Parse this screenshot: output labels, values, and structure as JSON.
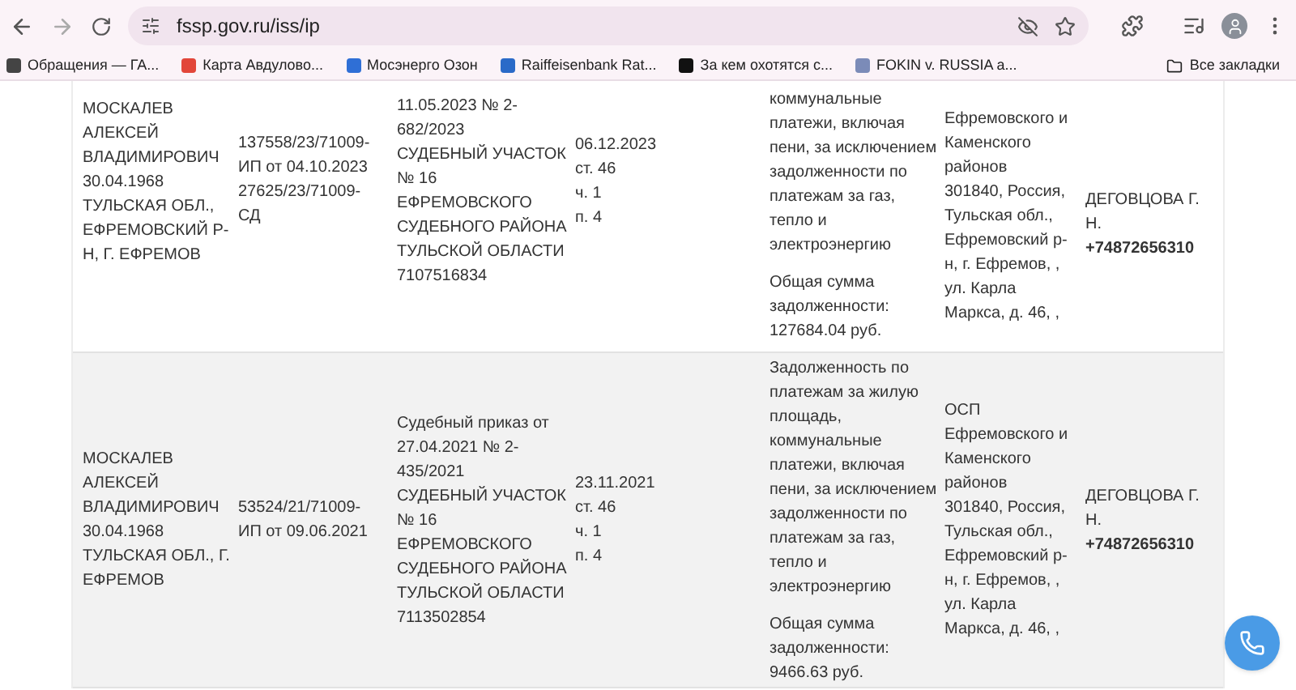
{
  "browser": {
    "url": "fssp.gov.ru/iss/ip",
    "all_bookmarks": "Все закладки",
    "bookmarks": [
      {
        "label": "Обращения — ГА...",
        "color": "#444444"
      },
      {
        "label": "Карта Авдулово...",
        "color": "#e2463a"
      },
      {
        "label": "Мосэнерго Озон",
        "color": "#2f6fd6"
      },
      {
        "label": "Raiffeisenbank Rat...",
        "color": "#2a6ac8"
      },
      {
        "label": "За кем охотятся с...",
        "color": "#111111"
      },
      {
        "label": "FOKIN v. RUSSIA a...",
        "color": "#7b8bb8"
      }
    ]
  },
  "rows": [
    {
      "hovered": false,
      "debtor": [
        "МОСКАЛЕВ",
        "АЛЕКСЕЙ",
        "ВЛАДИМИРОВИЧ",
        "30.04.1968",
        "ТУЛЬСКАЯ ОБЛ.,",
        "ЕФРЕМОВСКИЙ Р-",
        "Н, Г. ЕФРЕМОВ"
      ],
      "proceeding": [
        "137558/23/71009-",
        "ИП от 04.10.2023",
        "27625/23/71009-",
        "СД"
      ],
      "document": [
        "11.05.2023 № 2-",
        "682/2023",
        "СУДЕБНЫЙ УЧАСТОК",
        "№ 16",
        "ЕФРЕМОВСКОГО",
        "СУДЕБНОГО РАЙОНА",
        "ТУЛЬСКОЙ ОБЛАСТИ",
        "7107516834"
      ],
      "ended": [
        "06.12.2023",
        "ст. 46",
        "ч. 1",
        "п. 4"
      ],
      "subject": [
        "коммунальные",
        "платежи, включая",
        "пени, за исключением",
        "задолженности по",
        "платежам за газ,",
        "тепло и",
        "электроэнергию"
      ],
      "total": [
        "Общая сумма",
        "задолженности:",
        "127684.04 руб."
      ],
      "department": [
        "Ефремовского и",
        "Каменского",
        "районов",
        "301840, Россия,",
        "Тульская обл.,",
        "Ефремовский р-",
        "н, г. Ефремов, ,",
        "ул. Карла",
        "Маркса, д. 46, ,"
      ],
      "officer": [
        "ДЕГОВЦОВА Г.",
        "Н."
      ],
      "phone": "+74872656310"
    },
    {
      "hovered": true,
      "debtor": [
        "МОСКАЛЕВ",
        "АЛЕКСЕЙ",
        "ВЛАДИМИРОВИЧ",
        "30.04.1968",
        "ТУЛЬСКАЯ ОБЛ., Г.",
        "ЕФРЕМОВ"
      ],
      "proceeding": [
        "53524/21/71009-",
        "ИП от 09.06.2021"
      ],
      "document": [
        "Судебный приказ от",
        "27.04.2021 № 2-",
        "435/2021",
        "СУДЕБНЫЙ УЧАСТОК",
        "№ 16",
        "ЕФРЕМОВСКОГО",
        "СУДЕБНОГО РАЙОНА",
        "ТУЛЬСКОЙ ОБЛАСТИ",
        "7113502854"
      ],
      "ended": [
        "23.11.2021",
        "ст. 46",
        "ч. 1",
        "п. 4"
      ],
      "subject": [
        "Задолженность по",
        "платежам за жилую",
        "площадь,",
        "коммунальные",
        "платежи, включая",
        "пени, за исключением",
        "задолженности по",
        "платежам за газ,",
        "тепло и",
        "электроэнергию"
      ],
      "total": [
        "Общая сумма",
        "задолженности:",
        "9466.63 руб."
      ],
      "department": [
        "ОСП",
        "Ефремовского и",
        "Каменского",
        "районов",
        "301840, Россия,",
        "Тульская обл.,",
        "Ефремовский р-",
        "н, г. Ефремов, ,",
        "ул. Карла",
        "Маркса, д. 46, ,"
      ],
      "officer": [
        "ДЕГОВЦОВА Г.",
        "Н."
      ],
      "phone": "+74872656310"
    }
  ]
}
